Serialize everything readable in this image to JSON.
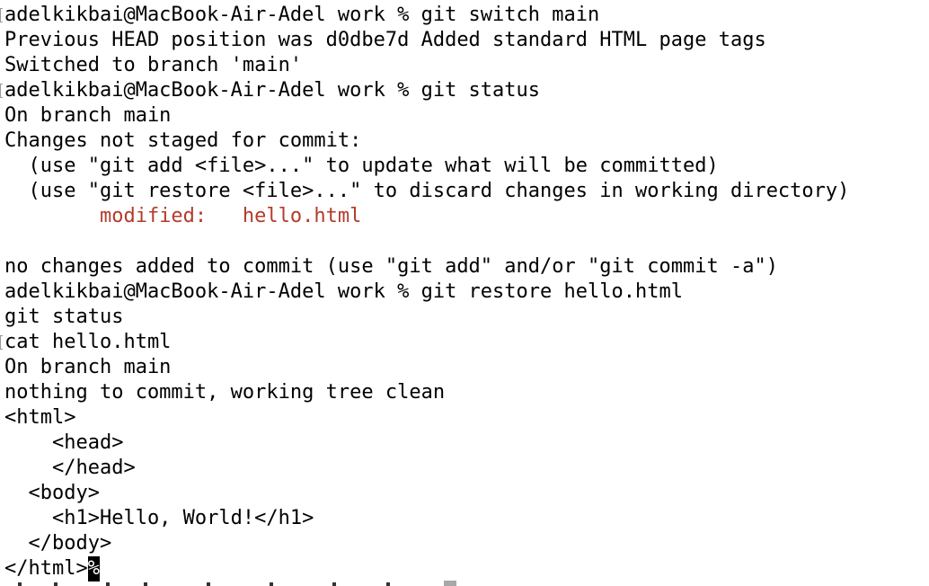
{
  "terminal": {
    "lines": [
      "adelkikbai@MacBook-Air-Adel work % git switch main",
      "Previous HEAD position was d0dbe7d Added standard HTML page tags",
      "Switched to branch 'main'",
      "adelkikbai@MacBook-Air-Adel work % git status",
      "On branch main",
      "Changes not staged for commit:",
      "  (use \"git add <file>...\" to update what will be committed)",
      "  (use \"git restore <file>...\" to discard changes in working directory)",
      "        modified:   hello.html",
      "",
      "no changes added to commit (use \"git add\" and/or \"git commit -a\")",
      "adelkikbai@MacBook-Air-Adel work % git restore hello.html",
      "git status",
      "cat hello.html",
      "On branch main",
      "nothing to commit, working tree clean",
      "<html>",
      "    <head>",
      "    </head>",
      "  <body>",
      "    <h1>Hello, World!</h1>",
      "  </body>",
      "</html>"
    ],
    "cursor_char": "%",
    "colors": {
      "background": "#ffffff",
      "text": "#000000",
      "modified": "#b43b2a",
      "cursor_bg": "#000000",
      "cursor_fg": "#ffffff"
    }
  }
}
